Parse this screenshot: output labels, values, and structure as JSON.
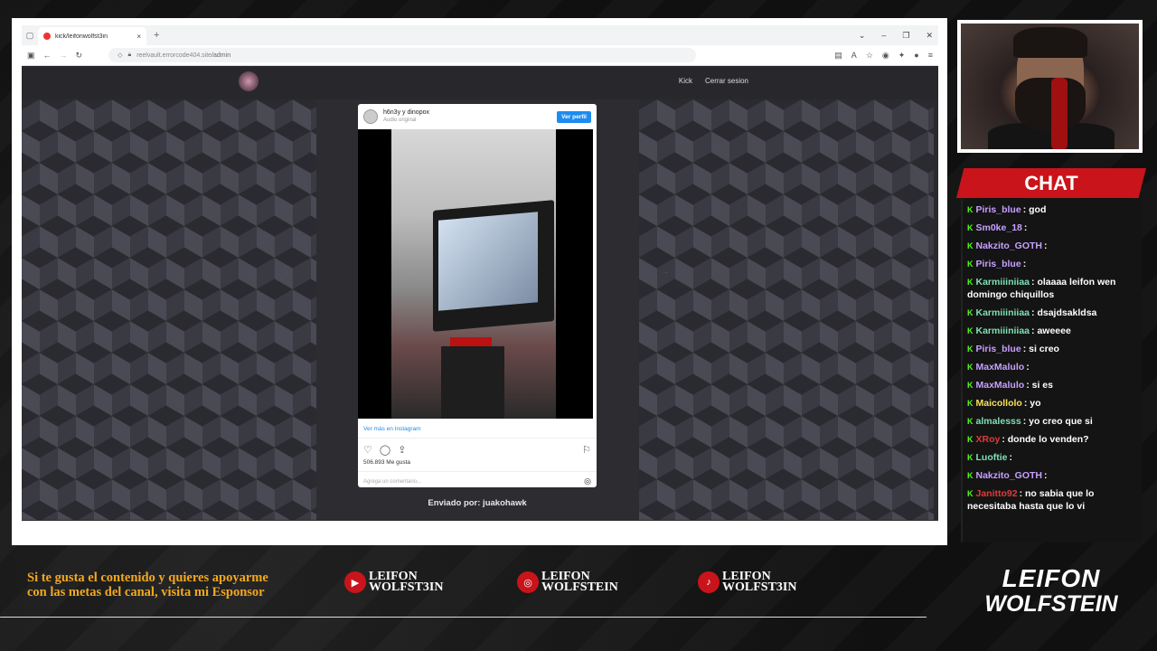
{
  "browser": {
    "tab_title": "kick/leifonwolfst3in",
    "tab_close": "×",
    "new_tab": "+",
    "win_controls": [
      "⌄",
      "–",
      "❐",
      "✕"
    ],
    "url_host": "reelvault.errorcode404.site",
    "url_path": "/admin"
  },
  "site": {
    "nav": [
      "Kick",
      "Cerrar sesion"
    ],
    "prev_arrow": "←",
    "next_arrow": "→",
    "sent_by": "Enviado por: juakohawk"
  },
  "instagram": {
    "user": "h6n3y y dinopox",
    "audio": "Audio original",
    "follow_label": "Ver perfil",
    "more_link": "Ver más en Instagram",
    "likes": "506.893 Me gusta",
    "comment_placeholder": "Agrega un comentario..."
  },
  "chat": {
    "title": "CHAT",
    "messages": [
      {
        "user": "Piris_blue",
        "text": ": god",
        "color": "#c6a0ff"
      },
      {
        "user": "Sm0ke_18",
        "text": ":",
        "color": "#c6a0ff"
      },
      {
        "user": "Nakzito_GOTH",
        "text": ":",
        "color": "#c6a0ff"
      },
      {
        "user": "Piris_blue",
        "text": ":",
        "color": "#c6a0ff"
      },
      {
        "user": "Karmiiiniiaa",
        "text": ": olaaaa leifon wen domingo chiquillos",
        "color": "#7ee0b6"
      },
      {
        "user": "Karmiiiniiaa",
        "text": ": dsajdsakldsa",
        "color": "#7ee0b6"
      },
      {
        "user": "Karmiiiniiaa",
        "text": ": aweeee",
        "color": "#7ee0b6"
      },
      {
        "user": "Piris_blue",
        "text": ": si creo",
        "color": "#c6a0ff"
      },
      {
        "user": "MaxMalulo",
        "text": ":",
        "color": "#c6a0ff"
      },
      {
        "user": "MaxMalulo",
        "text": ": si es",
        "color": "#c6a0ff"
      },
      {
        "user": "Maicollolo",
        "text": ": yo",
        "color": "#f4e05a"
      },
      {
        "user": "almalesss",
        "text": ": yo creo que si",
        "color": "#7ee0b6"
      },
      {
        "user": "XRoy",
        "text": ": donde lo venden?",
        "color": "#e03a3a"
      },
      {
        "user": "Luoftie",
        "text": ":",
        "color": "#7ee0b6"
      },
      {
        "user": "Nakzito_GOTH",
        "text": ":",
        "color": "#c6a0ff"
      },
      {
        "user": "Janitto92",
        "text": ": no sabia que lo necesitaba hasta que lo vi",
        "color": "#e03a3a"
      }
    ]
  },
  "footer": {
    "sponsor_text": "Si te gusta el contenido y quieres apoyarme con las metas del canal, visita mi Esponsor",
    "socials": [
      {
        "icon": "youtube-icon",
        "label": "LEIFON\nWOLFST3IN"
      },
      {
        "icon": "instagram-icon",
        "label": "LEIFON\nWOLFSTEIN"
      },
      {
        "icon": "tiktok-icon",
        "label": "LEIFON\nWOLFST3IN"
      }
    ],
    "logo_line1": "LEIFON",
    "logo_line2": "WOLFSTEIN"
  }
}
